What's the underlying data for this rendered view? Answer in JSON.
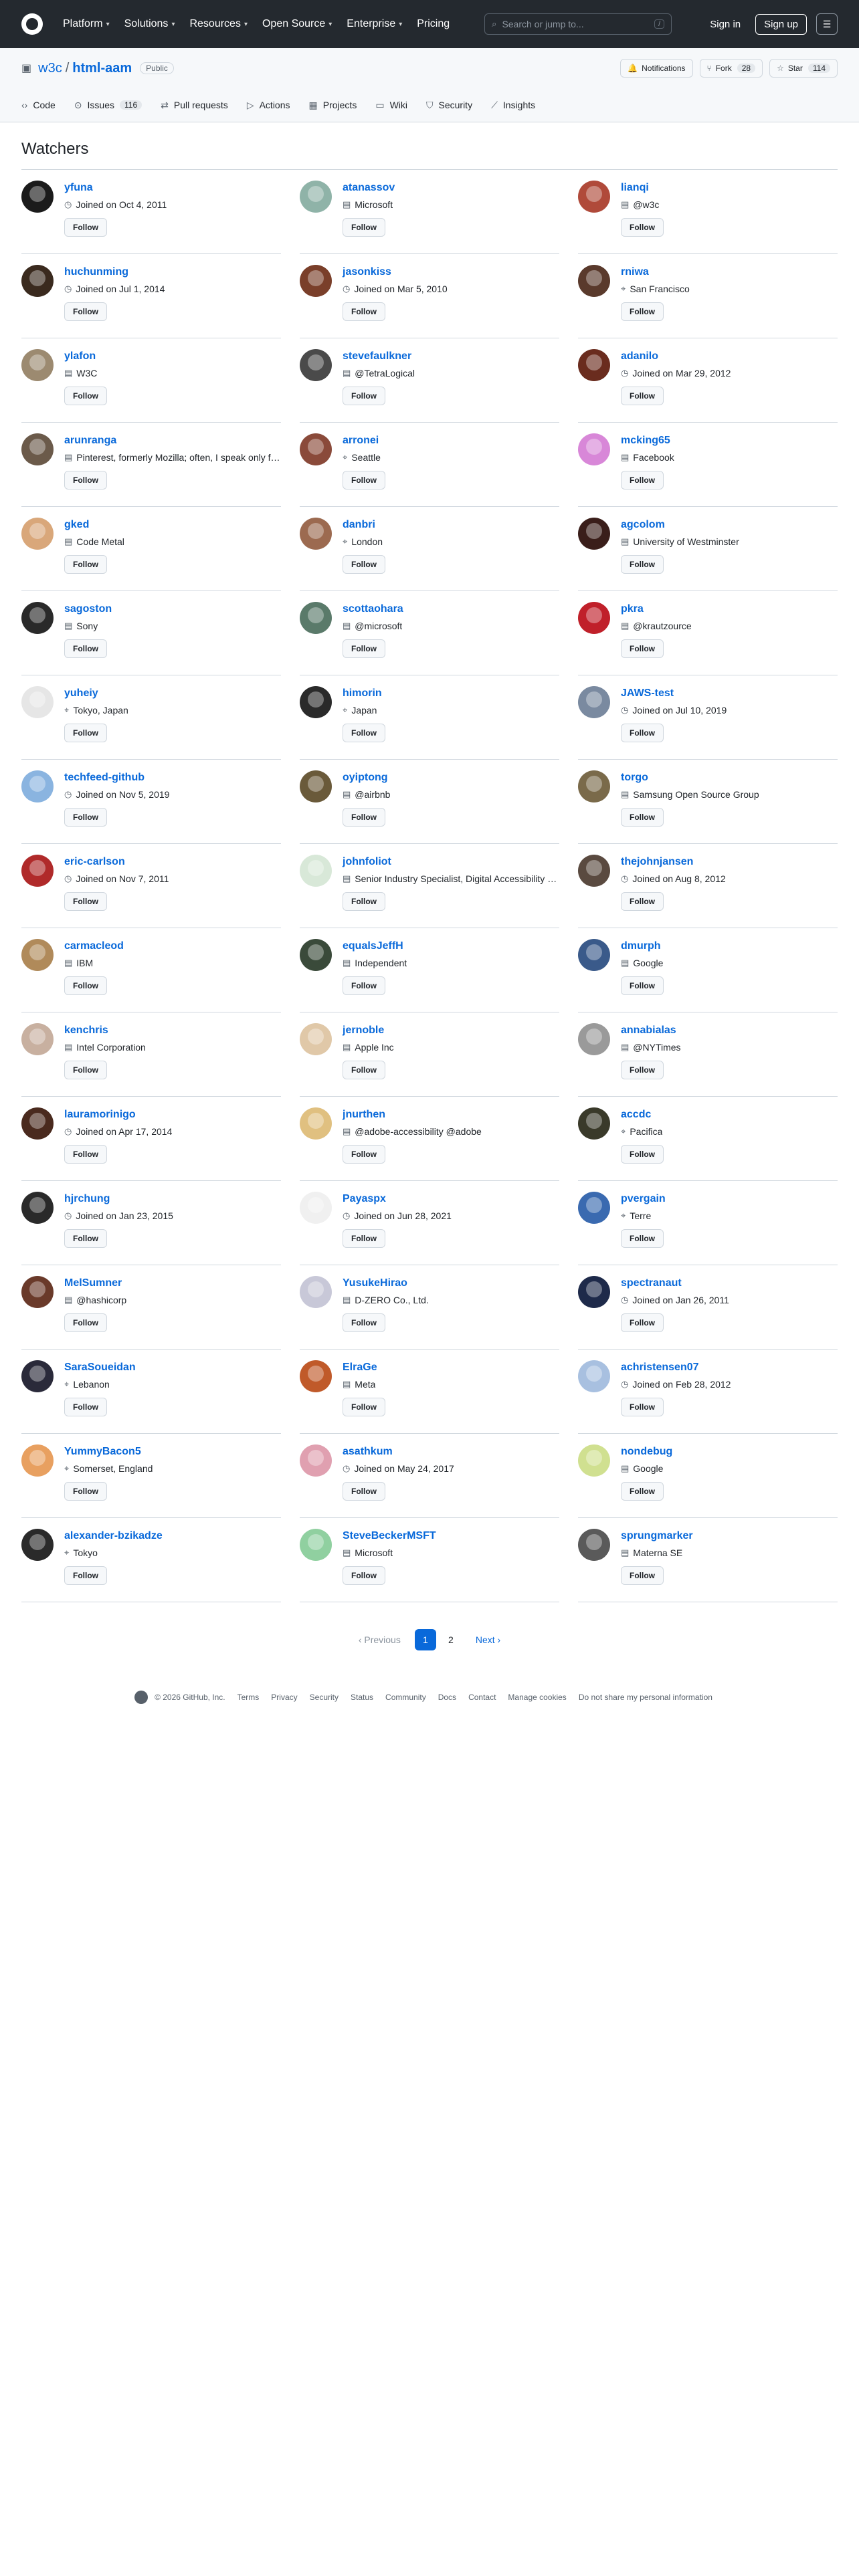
{
  "header": {
    "nav": [
      "Platform",
      "Solutions",
      "Resources",
      "Open Source",
      "Enterprise",
      "Pricing"
    ],
    "search_placeholder": "Search or jump to...",
    "search_kbd": "/",
    "signin": "Sign in",
    "signup": "Sign up"
  },
  "repo": {
    "owner": "w3c",
    "slash": "/",
    "name": "html-aam",
    "visibility": "Public",
    "notifications": "Notifications",
    "fork_label": "Fork",
    "fork_count": "28",
    "star_label": "Star",
    "star_count": "114",
    "tabs": [
      {
        "label": "Code",
        "icon": "code-icon",
        "glyph": "‹›"
      },
      {
        "label": "Issues",
        "icon": "issue-icon",
        "glyph": "⊙",
        "count": "116"
      },
      {
        "label": "Pull requests",
        "icon": "pull-request-icon",
        "glyph": "⇄"
      },
      {
        "label": "Actions",
        "icon": "actions-icon",
        "glyph": "▷"
      },
      {
        "label": "Projects",
        "icon": "projects-icon",
        "glyph": "▦"
      },
      {
        "label": "Wiki",
        "icon": "wiki-icon",
        "glyph": "▭"
      },
      {
        "label": "Security",
        "icon": "shield-icon",
        "glyph": "⛉"
      },
      {
        "label": "Insights",
        "icon": "graph-icon",
        "glyph": "⟋"
      }
    ]
  },
  "page_title": "Watchers",
  "follow_label": "Follow",
  "watchers": [
    {
      "login": "yfuna",
      "meta": "Joined on Oct 4, 2011",
      "meta_icon": "clock-icon",
      "color": "#1b1b1b"
    },
    {
      "login": "atanassov",
      "meta": "Microsoft",
      "meta_icon": "organization-icon",
      "color": "#8fb3a8"
    },
    {
      "login": "lianqi",
      "meta": "@w3c",
      "meta_icon": "organization-icon",
      "color": "#b04a3a"
    },
    {
      "login": "huchunming",
      "meta": "Joined on Jul 1, 2014",
      "meta_icon": "clock-icon",
      "color": "#3a2a1e"
    },
    {
      "login": "jasonkiss",
      "meta": "Joined on Mar 5, 2010",
      "meta_icon": "clock-icon",
      "color": "#7a3f2a"
    },
    {
      "login": "rniwa",
      "meta": "San Francisco",
      "meta_icon": "location-icon",
      "color": "#5a3a2c"
    },
    {
      "login": "ylafon",
      "meta": "W3C",
      "meta_icon": "organization-icon",
      "color": "#9c8a70"
    },
    {
      "login": "stevefaulkner",
      "meta": "@TetraLogical",
      "meta_icon": "organization-icon",
      "color": "#4a4a4a"
    },
    {
      "login": "adanilo",
      "meta": "Joined on Mar 29, 2012",
      "meta_icon": "clock-icon",
      "color": "#6a2c1e"
    },
    {
      "login": "arunranga",
      "meta": "Pinterest, formerly Mozilla; often, I speak only for myself",
      "meta_icon": "organization-icon",
      "color": "#6b5a4a"
    },
    {
      "login": "arronei",
      "meta": "Seattle",
      "meta_icon": "location-icon",
      "color": "#8a4a3a"
    },
    {
      "login": "mcking65",
      "meta": "Facebook",
      "meta_icon": "organization-icon",
      "color": "#d887d8"
    },
    {
      "login": "gked",
      "meta": "Code Metal",
      "meta_icon": "organization-icon",
      "color": "#d9a77a"
    },
    {
      "login": "danbri",
      "meta": "London",
      "meta_icon": "location-icon",
      "color": "#9c6a50"
    },
    {
      "login": "agcolom",
      "meta": "University of Westminster",
      "meta_icon": "organization-icon",
      "color": "#3a1e1a"
    },
    {
      "login": "sagoston",
      "meta": "Sony",
      "meta_icon": "organization-icon",
      "color": "#2a2a2a"
    },
    {
      "login": "scottaohara",
      "meta": "@microsoft",
      "meta_icon": "organization-icon",
      "color": "#5a7a6a"
    },
    {
      "login": "pkra",
      "meta": "@krautzource",
      "meta_icon": "organization-icon",
      "color": "#c0202a"
    },
    {
      "login": "yuheiy",
      "meta": "Tokyo, Japan",
      "meta_icon": "location-icon",
      "color": "#e6e6e6"
    },
    {
      "login": "himorin",
      "meta": "Japan",
      "meta_icon": "location-icon",
      "color": "#2a2a2a"
    },
    {
      "login": "JAWS-test",
      "meta": "Joined on Jul 10, 2019",
      "meta_icon": "clock-icon",
      "color": "#7a8aa0"
    },
    {
      "login": "techfeed-github",
      "meta": "Joined on Nov 5, 2019",
      "meta_icon": "clock-icon",
      "color": "#8ab4e0"
    },
    {
      "login": "oyiptong",
      "meta": "@airbnb",
      "meta_icon": "organization-icon",
      "color": "#6a5a3a"
    },
    {
      "login": "torgo",
      "meta": "Samsung Open Source Group",
      "meta_icon": "organization-icon",
      "color": "#7a6a4a"
    },
    {
      "login": "eric-carlson",
      "meta": "Joined on Nov 7, 2011",
      "meta_icon": "clock-icon",
      "color": "#b02a2a"
    },
    {
      "login": "johnfoliot",
      "meta": "Senior Industry Specialist, Digital Accessibility at Vispero",
      "meta_icon": "organization-icon",
      "color": "#d8e8d8"
    },
    {
      "login": "thejohnjansen",
      "meta": "Joined on Aug 8, 2012",
      "meta_icon": "clock-icon",
      "color": "#5a4a40"
    },
    {
      "login": "carmacleod",
      "meta": "IBM",
      "meta_icon": "organization-icon",
      "color": "#b08a5a"
    },
    {
      "login": "equalsJeffH",
      "meta": "Independent",
      "meta_icon": "organization-icon",
      "color": "#3a4a3a"
    },
    {
      "login": "dmurph",
      "meta": "Google",
      "meta_icon": "organization-icon",
      "color": "#3a5a8a"
    },
    {
      "login": "kenchris",
      "meta": "Intel Corporation",
      "meta_icon": "organization-icon",
      "color": "#c8b0a0"
    },
    {
      "login": "jernoble",
      "meta": "Apple Inc",
      "meta_icon": "organization-icon",
      "color": "#e0c8a8"
    },
    {
      "login": "annabialas",
      "meta": "@NYTimes",
      "meta_icon": "organization-icon",
      "color": "#9a9a9a"
    },
    {
      "login": "lauramorinigo",
      "meta": "Joined on Apr 17, 2014",
      "meta_icon": "clock-icon",
      "color": "#4a2a1e"
    },
    {
      "login": "jnurthen",
      "meta": "@adobe-accessibility @adobe",
      "meta_icon": "organization-icon",
      "color": "#e0c080"
    },
    {
      "login": "accdc",
      "meta": "Pacifica",
      "meta_icon": "location-icon",
      "color": "#3a3a2a"
    },
    {
      "login": "hjrchung",
      "meta": "Joined on Jan 23, 2015",
      "meta_icon": "clock-icon",
      "color": "#2a2a2a"
    },
    {
      "login": "Payaspx",
      "meta": "Joined on Jun 28, 2021",
      "meta_icon": "clock-icon",
      "color": "#f0f0f0"
    },
    {
      "login": "pvergain",
      "meta": "Terre",
      "meta_icon": "location-icon",
      "color": "#3a6ab0"
    },
    {
      "login": "MelSumner",
      "meta": "@hashicorp",
      "meta_icon": "organization-icon",
      "color": "#6a3a2a"
    },
    {
      "login": "YusukeHirao",
      "meta": "D-ZERO Co., Ltd.",
      "meta_icon": "organization-icon",
      "color": "#c8c8d8"
    },
    {
      "login": "spectranaut",
      "meta": "Joined on Jan 26, 2011",
      "meta_icon": "clock-icon",
      "color": "#1e2a4a"
    },
    {
      "login": "SaraSoueidan",
      "meta": "Lebanon",
      "meta_icon": "location-icon",
      "color": "#2a2a3a"
    },
    {
      "login": "ElraGe",
      "meta": "Meta",
      "meta_icon": "organization-icon",
      "color": "#c05a2a"
    },
    {
      "login": "achristensen07",
      "meta": "Joined on Feb 28, 2012",
      "meta_icon": "clock-icon",
      "color": "#a8c0e0"
    },
    {
      "login": "YummyBacon5",
      "meta": "Somerset, England",
      "meta_icon": "location-icon",
      "color": "#e8a060"
    },
    {
      "login": "asathkum",
      "meta": "Joined on May 24, 2017",
      "meta_icon": "clock-icon",
      "color": "#e0a0b0"
    },
    {
      "login": "nondebug",
      "meta": "Google",
      "meta_icon": "organization-icon",
      "color": "#d0e090"
    },
    {
      "login": "alexander-bzikadze",
      "meta": "Tokyo",
      "meta_icon": "location-icon",
      "color": "#2a2a2a"
    },
    {
      "login": "SteveBeckerMSFT",
      "meta": "Microsoft",
      "meta_icon": "organization-icon",
      "color": "#90d0a0"
    },
    {
      "login": "sprungmarker",
      "meta": "Materna SE",
      "meta_icon": "organization-icon",
      "color": "#5a5a5a"
    }
  ],
  "pagination": {
    "previous": "‹ Previous",
    "pages": [
      "1",
      "2"
    ],
    "current": "1",
    "next": "Next ›"
  },
  "footer": {
    "copyright": "© 2026 GitHub, Inc.",
    "links": [
      "Terms",
      "Privacy",
      "Security",
      "Status",
      "Community",
      "Docs",
      "Contact",
      "Manage cookies",
      "Do not share my personal information"
    ]
  }
}
